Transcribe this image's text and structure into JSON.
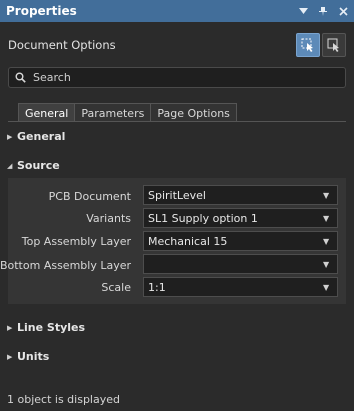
{
  "window": {
    "title": "Properties"
  },
  "header": {
    "doc_title": "Document Options"
  },
  "search": {
    "placeholder": "Search"
  },
  "tabs": [
    {
      "label": "General",
      "active": true
    },
    {
      "label": "Parameters",
      "active": false
    },
    {
      "label": "Page Options",
      "active": false
    }
  ],
  "sections": {
    "general": "General",
    "source": "Source",
    "line_styles": "Line Styles",
    "units": "Units"
  },
  "source": {
    "fields": [
      {
        "label": "PCB Document",
        "value": "SpiritLevel"
      },
      {
        "label": "Variants",
        "value": "SL1 Supply option 1"
      },
      {
        "label": "Top Assembly Layer",
        "value": "Mechanical 15"
      },
      {
        "label": "Bottom Assembly Layer",
        "value": ""
      },
      {
        "label": "Scale",
        "value": "1:1"
      }
    ]
  },
  "status": {
    "text": "1 object is displayed"
  },
  "colors": {
    "titlebar": "#426e9a",
    "background": "#2b2b2b",
    "accent": "#5d8ab8"
  }
}
